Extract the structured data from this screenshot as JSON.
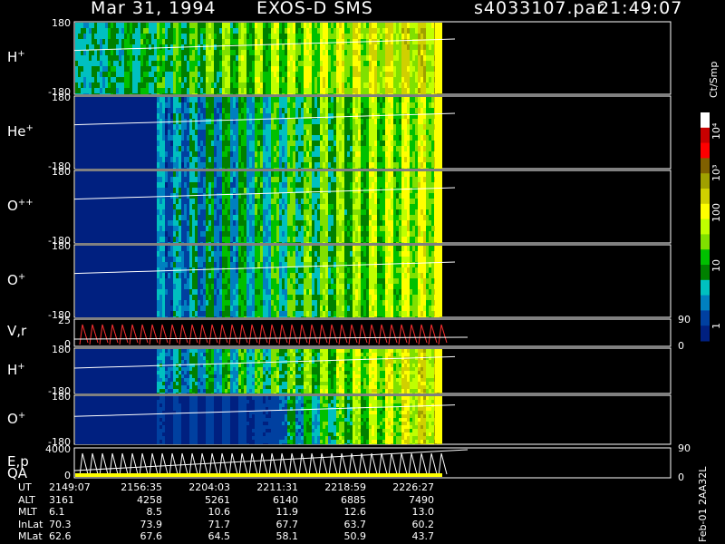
{
  "header": {
    "date": "Mar 31, 1994",
    "instrument": "EXOS-D SMS",
    "file": "s4033107.par",
    "time": "21:49:07"
  },
  "panels": [
    {
      "label": "H",
      "charge": "+",
      "ytop": "180",
      "ybot": "-180",
      "species": "hplus"
    },
    {
      "label": "He",
      "charge": "+",
      "ytop": "180",
      "ybot": "-180",
      "species": "heplus"
    },
    {
      "label": "O",
      "charge": "++",
      "ytop": "180",
      "ybot": "-180",
      "species": "oplusplus"
    },
    {
      "label": "O",
      "charge": "+",
      "ytop": "180",
      "ybot": "-180",
      "species": "oplus"
    },
    {
      "label": "V,r",
      "charge": "",
      "ytop": "25",
      "ybot": "0",
      "right_top": "90",
      "right_bot": "0"
    },
    {
      "label": "H",
      "charge": "+",
      "ytop": "180",
      "ybot": "-180",
      "species": "hplus2"
    },
    {
      "label": "O",
      "charge": "+",
      "ytop": "180",
      "ybot": "-180",
      "species": "oplus2"
    },
    {
      "label": "E,p",
      "label2": "QA",
      "charge": "",
      "ytop": "4000",
      "ybot": "0",
      "right_top": "90",
      "right_bot": "0"
    }
  ],
  "colorbar": {
    "unit": "Ct/Smp",
    "ticks": [
      "10⁴",
      "10³",
      "100",
      "10",
      "1"
    ],
    "colors": [
      "#ffffff",
      "#c80000",
      "#ff0000",
      "#806000",
      "#a0a000",
      "#d0d000",
      "#ffff00",
      "#c0ff00",
      "#80e000",
      "#00c000",
      "#008000",
      "#00c0c0",
      "#0080c0",
      "#0040a0",
      "#002080"
    ]
  },
  "footer": {
    "rows": [
      {
        "name": "UT",
        "values": [
          "2149:07",
          "2156:35",
          "2204:03",
          "2211:31",
          "2218:59",
          "2226:27"
        ]
      },
      {
        "name": "ALT",
        "values": [
          "3161",
          "4258",
          "5261",
          "6140",
          "6885",
          "7490"
        ]
      },
      {
        "name": "MLT",
        "values": [
          "6.1",
          "8.5",
          "10.6",
          "11.9",
          "12.6",
          "13.0"
        ]
      },
      {
        "name": "InLat",
        "values": [
          "70.3",
          "73.9",
          "71.7",
          "67.7",
          "63.7",
          "60.2"
        ]
      },
      {
        "name": "MLat",
        "values": [
          "62.6",
          "67.6",
          "64.5",
          "58.1",
          "50.9",
          "43.7"
        ]
      }
    ],
    "stamp": "Feb-01 2AA32L"
  },
  "chart_data": {
    "type": "heatmap",
    "title": "Mar 31, 1994   EXOS-D SMS",
    "x_ticks": [
      "2149:07",
      "2156:35",
      "2204:03",
      "2211:31",
      "2218:59",
      "2226:27"
    ],
    "series": [
      {
        "name": "H+",
        "ylim": [
          -180,
          180
        ]
      },
      {
        "name": "He+",
        "ylim": [
          -180,
          180
        ]
      },
      {
        "name": "O++",
        "ylim": [
          -180,
          180
        ]
      },
      {
        "name": "O+",
        "ylim": [
          -180,
          180
        ]
      },
      {
        "name": "V,r",
        "ylim": [
          0,
          25
        ]
      },
      {
        "name": "H+",
        "ylim": [
          -180,
          180
        ]
      },
      {
        "name": "O+",
        "ylim": [
          -180,
          180
        ]
      },
      {
        "name": "E,p",
        "ylim": [
          0,
          4000
        ]
      }
    ],
    "colorbar_range": [
      1,
      10000
    ],
    "colorbar_scale": "log"
  }
}
